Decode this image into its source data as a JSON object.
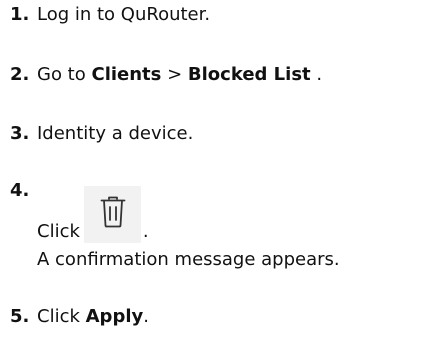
{
  "steps": [
    {
      "num": "1.",
      "text": "Log in to QuRouter."
    },
    {
      "num": "2.",
      "prefix": "Go to ",
      "b1": "Clients",
      "sep": " > ",
      "b2": "Blocked List",
      "suffix": " ."
    },
    {
      "num": "3.",
      "text": "Identity a device."
    },
    {
      "num": "4.",
      "click": "Click",
      "after_icon": ".",
      "icon": "trash-icon",
      "note": "A confirmation message appears."
    },
    {
      "num": "5.",
      "prefix": "Click ",
      "b1": "Apply",
      "suffix": "."
    }
  ]
}
